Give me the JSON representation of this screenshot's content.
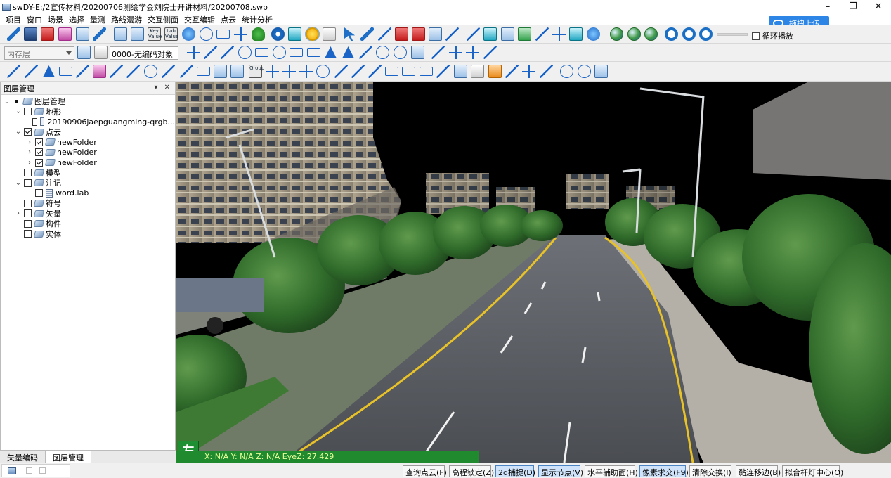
{
  "window": {
    "title": "swDY-E:/2宣传材料/20200706测绘学会刘院士开讲材料/20200708.swp",
    "controls": [
      "–",
      "❐",
      "✕"
    ]
  },
  "menu": [
    "项目",
    "窗口",
    "场景",
    "选择",
    "量测",
    "路线漫游",
    "交互侧面",
    "交互编辑",
    "点云",
    "统计分析"
  ],
  "cloud_upload": {
    "label": "拖拽上传"
  },
  "toolbar1": {
    "loop_play_label": "循环播放",
    "key_value_label": "Key Value",
    "lab_value_label": "Lab Value",
    "group_label": "Group"
  },
  "toolbar2": {
    "layer_combo_value": "内存层",
    "code_value": "0000-无编码对象"
  },
  "panel": {
    "title": "图层管理",
    "pin_controls": "▾ ✕",
    "tabs": [
      "矢量编码",
      "图层管理"
    ],
    "active_tab": 1,
    "tree": [
      {
        "label": "图层管理",
        "depth": 0,
        "expanded": true,
        "check": "partial",
        "icon": "folder"
      },
      {
        "label": "地形",
        "depth": 1,
        "expanded": true,
        "check": "off",
        "icon": "folder"
      },
      {
        "label": "20190906jaepguangming-qrgb...",
        "depth": 2,
        "expanded": null,
        "check": "off",
        "icon": "data"
      },
      {
        "label": "点云",
        "depth": 1,
        "expanded": true,
        "check": "on",
        "icon": "folder"
      },
      {
        "label": "newFolder",
        "depth": 2,
        "expanded": false,
        "check": "on",
        "icon": "folder"
      },
      {
        "label": "newFolder",
        "depth": 2,
        "expanded": false,
        "check": "on",
        "icon": "folder"
      },
      {
        "label": "newFolder",
        "depth": 2,
        "expanded": false,
        "check": "on",
        "icon": "folder"
      },
      {
        "label": "模型",
        "depth": 1,
        "expanded": null,
        "check": "off",
        "icon": "folder"
      },
      {
        "label": "注记",
        "depth": 1,
        "expanded": true,
        "check": "off",
        "icon": "folder"
      },
      {
        "label": "word.lab",
        "depth": 2,
        "expanded": null,
        "check": "off",
        "icon": "data"
      },
      {
        "label": "符号",
        "depth": 1,
        "expanded": null,
        "check": "off",
        "icon": "folder"
      },
      {
        "label": "矢量",
        "depth": 1,
        "expanded": false,
        "check": "off",
        "icon": "folder"
      },
      {
        "label": "构件",
        "depth": 1,
        "expanded": null,
        "check": "off",
        "icon": "folder"
      },
      {
        "label": "实体",
        "depth": 1,
        "expanded": null,
        "check": "off",
        "icon": "folder"
      }
    ]
  },
  "viewport": {
    "side_badge": "左",
    "coords_text": "X: N/A Y: N/A Z: N/A EyeZ: 27.429"
  },
  "statusbar": {
    "buttons": [
      {
        "label": "查询点云(F)",
        "active": false
      },
      {
        "label": "高程锁定(Z)",
        "active": false
      },
      {
        "label": "2d捕捉(D)",
        "active": true
      },
      {
        "label": "显示节点(V)",
        "active": true
      },
      {
        "label": "水平辅助面(H)",
        "active": false
      },
      {
        "label": "像素求交(F9)",
        "active": true
      },
      {
        "label": "清除交换(I)",
        "active": false
      },
      {
        "label": "黏连移边(B)",
        "active": false
      },
      {
        "label": "拟合杆灯中心(O)",
        "active": false
      }
    ]
  }
}
